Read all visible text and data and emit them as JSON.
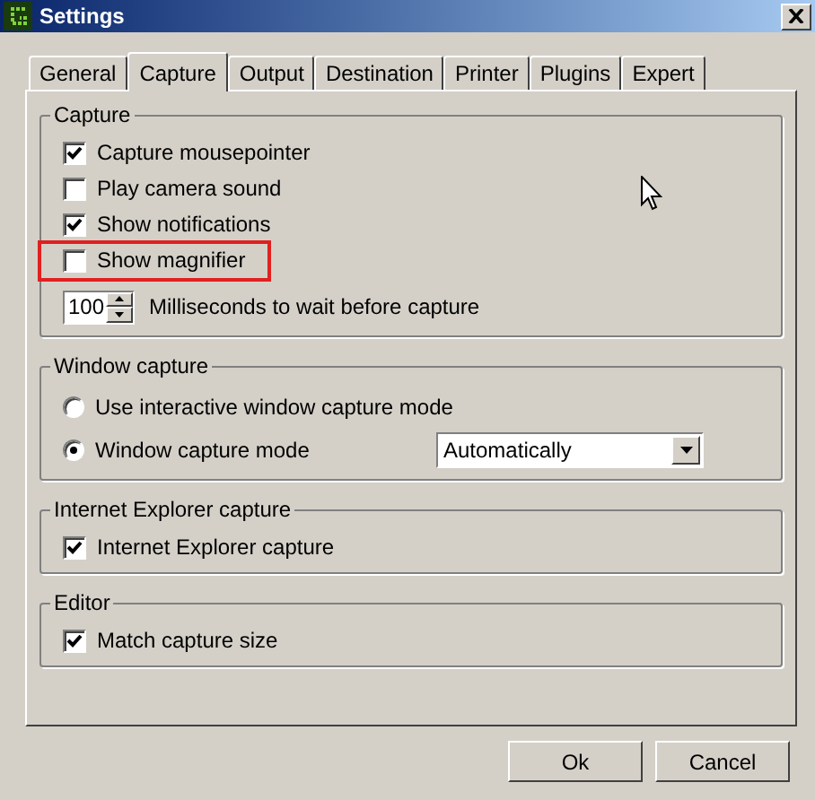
{
  "window": {
    "title": "Settings"
  },
  "tabs": [
    {
      "label": "General",
      "selected": false
    },
    {
      "label": "Capture",
      "selected": true
    },
    {
      "label": "Output",
      "selected": false
    },
    {
      "label": "Destination",
      "selected": false
    },
    {
      "label": "Printer",
      "selected": false
    },
    {
      "label": "Plugins",
      "selected": false
    },
    {
      "label": "Expert",
      "selected": false
    }
  ],
  "groups": [
    {
      "title": "Capture",
      "items": [
        {
          "kind": "checkbox",
          "label": "Capture mousepointer",
          "checked": true,
          "highlighted": false
        },
        {
          "kind": "checkbox",
          "label": "Play camera sound",
          "checked": false,
          "highlighted": false
        },
        {
          "kind": "checkbox",
          "label": "Show notifications",
          "checked": true,
          "highlighted": false
        },
        {
          "kind": "checkbox",
          "label": "Show magnifier",
          "checked": false,
          "highlighted": true
        },
        {
          "kind": "spinner",
          "value": "100",
          "label": "Milliseconds to wait before capture"
        }
      ]
    },
    {
      "title": "Window capture",
      "items": [
        {
          "kind": "radio",
          "label": "Use interactive window capture mode",
          "selected": false
        },
        {
          "kind": "radio",
          "label": "Window capture mode",
          "selected": true,
          "dropdown": "Automatically"
        }
      ]
    },
    {
      "title": "Internet Explorer capture",
      "items": [
        {
          "kind": "checkbox",
          "label": "Internet Explorer capture",
          "checked": true,
          "highlighted": false
        }
      ]
    },
    {
      "title": "Editor",
      "items": [
        {
          "kind": "checkbox",
          "label": "Match capture size",
          "checked": true,
          "highlighted": false
        }
      ]
    }
  ],
  "buttons": [
    "Ok",
    "Cancel"
  ]
}
